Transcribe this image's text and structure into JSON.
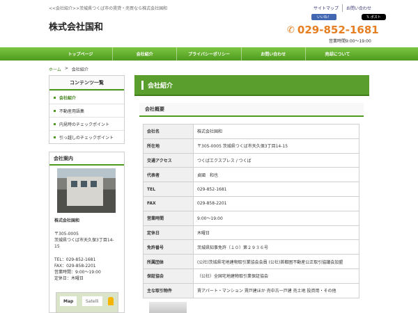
{
  "header": {
    "tagline": "<<会社紹介>>茨城県つくば市の賃貸・売買なら株式会社国和",
    "top_links": [
      "サイトマップ",
      "お問い合わせ"
    ],
    "fb_like": "いいね！",
    "tw_post": "ポスト",
    "company_name": "株式会社国和",
    "phone": "029-852-1681",
    "hours": "営業時間9:00～19:00"
  },
  "nav": [
    "トップページ",
    "会社紹介",
    "プライバシーポリシー",
    "お問い合わせ",
    "売却について"
  ],
  "breadcrumb": {
    "home": "ホーム",
    "sep": ">",
    "current": "会社紹介"
  },
  "sidebar": {
    "contents_title": "コンテンツ一覧",
    "items": [
      {
        "label": "会社紹介"
      },
      {
        "label": "不動産用語集"
      },
      {
        "label": "内見時のチェックポイント"
      },
      {
        "label": "引っ越しのチェックポイント"
      }
    ],
    "info_title": "会社案内",
    "info_name": "株式会社国和",
    "info_postal": "〒305-0005",
    "info_address1": "茨城県つくば市天久保3丁目14-",
    "info_address2": "15",
    "info_tel": "TEL：029-852-1681",
    "info_fax": "FAX：029-858-2201",
    "info_hours": "営業時間：9:00～19:00",
    "info_holiday": "定休日：木曜日",
    "map_tab": "Map",
    "satellite_tab": "Satelli"
  },
  "main": {
    "title": "会社紹介",
    "section": "会社概要",
    "rows": [
      {
        "k": "会社名",
        "v": "株式会社国和"
      },
      {
        "k": "所在地",
        "v": "〒305-0005 茨城県つくば市天久保3丁目14-15"
      },
      {
        "k": "交通アクセス",
        "v": "つくばエクスプレス / つくば"
      },
      {
        "k": "代表者",
        "v": "貞國　和也"
      },
      {
        "k": "TEL",
        "v": "029-852-1681"
      },
      {
        "k": "FAX",
        "v": "029-858-2201"
      },
      {
        "k": "営業時間",
        "v": "9:00～19:00"
      },
      {
        "k": "定休日",
        "v": "木曜日"
      },
      {
        "k": "免許番号",
        "v": "茨城県知事免許（１０）第２９３６号"
      },
      {
        "k": "所属団体",
        "v": "(公社)茨城県宅地建物取引業協会会員 (公社)首都圏不動産公正取引協議会加盟"
      },
      {
        "k": "保証協会",
        "v": "（公社）全国宅地建物取引業保証協会"
      },
      {
        "k": "主な取引物件",
        "v": "賃アパート・マンション 賃戸建ほか 売中古一戸建 売土地 投資用・その他"
      }
    ]
  },
  "colors": {
    "accent": "#4e9a1e",
    "phone": "#e67e22"
  }
}
